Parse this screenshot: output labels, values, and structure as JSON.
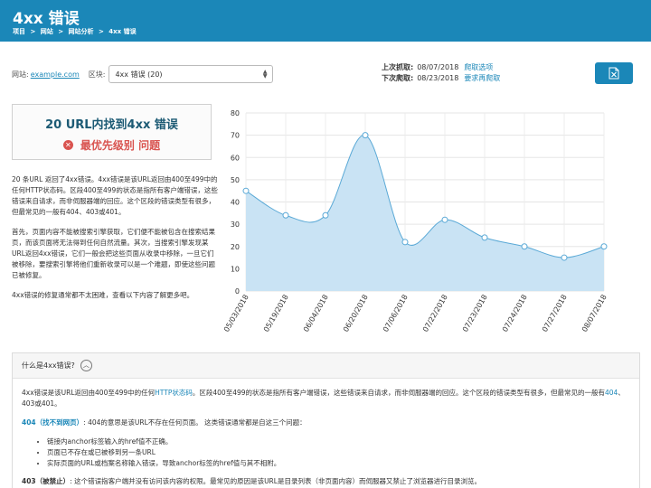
{
  "header": {
    "title": "4xx 错误",
    "breadcrumbs": [
      "项目",
      ">",
      "网站",
      ">",
      "网站分析",
      ">",
      "4xx 错误"
    ]
  },
  "filters": {
    "site_label": "网站:",
    "site_value": "example.com",
    "block_label": "区块:",
    "block_value": "4xx 错误 (20)"
  },
  "crawl": {
    "last_label": "上次抓取:",
    "last_value": "08/07/2018",
    "last_link": "爬取选项",
    "next_label": "下次爬取:",
    "next_value": "08/23/2018",
    "next_link": "要求再爬取"
  },
  "export": {
    "icon": "excel-icon"
  },
  "summary": {
    "line1": "20 URL内找到4xx 错误",
    "line2": "最优先级别 问题",
    "icon": "error-circle-icon",
    "color": "#d9534f"
  },
  "description": {
    "p1": "20 条URL 返回了4xx错误。4xx错误是该URL返回由400至499中的任何HTTP状态码。区段400至499的状态是指所有客户端错误，这些错误来自请求，而非伺服器端的回应。这个区段的错误类型有很多，但最常见的一般有404、403或401。",
    "p2": "首先，页面内容不能被搜索引擎获取，它们便不能被包含在搜索结果页，而该页面将无法得到任何自然流量。其次，当搜索引擎发现某URL返回4xx错误，它们一般会把这些页面从收录中移除，一旦它们被移除，要搜索引擎将他们重新收录可以是一个难题，即使这些问题已被修复。",
    "p3": "4xx错误的修复通常都不太困难，查看以下内容了解更多吧。"
  },
  "chart_data": {
    "type": "area",
    "x": [
      "05/03/2018",
      "05/19/2018",
      "06/04/2018",
      "06/20/2018",
      "07/06/2018",
      "07/22/2018",
      "07/23/2018",
      "07/24/2018",
      "07/27/2018",
      "08/07/2018"
    ],
    "values": [
      45,
      34,
      34,
      70,
      22,
      32,
      24,
      20,
      15,
      20
    ],
    "ylim": [
      0,
      80
    ],
    "yticks": [
      0,
      10,
      20,
      30,
      40,
      50,
      60,
      70,
      80
    ],
    "grid": true,
    "color": "#5aa9d6",
    "fill": "#c9e3f4"
  },
  "faq": {
    "question": "什么是4xx错误?",
    "toggle_icon": "chevron-up-icon",
    "p1_pre": "4xx错误是该URL返回由400至499中的任何",
    "p1_link": "HTTP状态码",
    "p1_mid": "。区段400至499的状态是指所有客户端错误，这些错误来自请求，而非伺服器端的回应。这个区段的错误类型有很多，但最常见的一般有",
    "p1_link2": "404",
    "p1_end": "、403或401。",
    "p2_head": "404（找不到网页）",
    "p2_body": ": 404的意思是该URL不存在任何页面。 这类错误通常都是自这三个问题：",
    "bullets": [
      "链接内anchor标签输入的href值不正确。",
      "页面已不存在或已被移到另一条URL",
      "实际页面的URL或档案名称输入错误，导致anchor标签的href值与其不相附。"
    ],
    "p3_head": "403（被禁止）",
    "p3_body": ": 这个错误指客户端并没有访问该内容的权限。最常见的原因是该URL是目录列表（非页面内容）而伺服器又禁止了浏览器进行目录浏览。"
  }
}
